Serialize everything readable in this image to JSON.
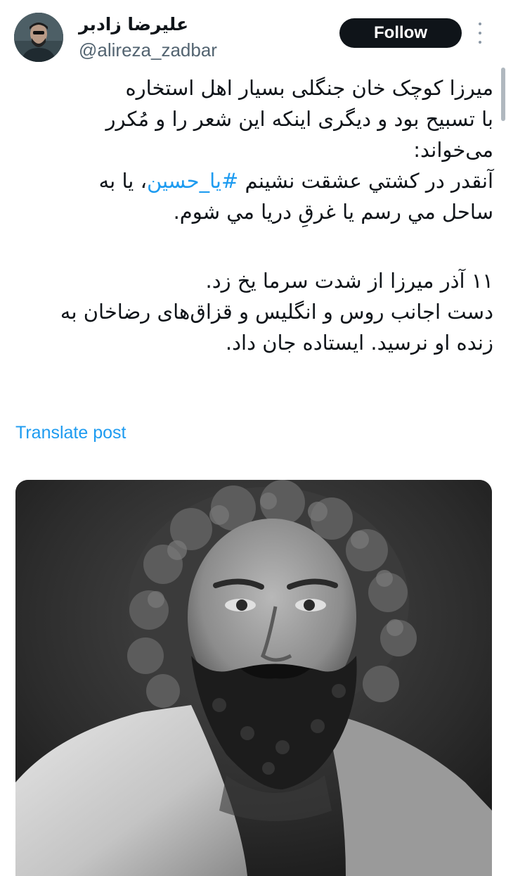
{
  "author": {
    "display_name": "علیرضا زادبر",
    "handle": "@alireza_zadbar"
  },
  "header": {
    "follow_label": "Follow",
    "more_icon": "more-vertical-icon"
  },
  "tweet": {
    "line1": "میرزا کوچک خان جنگلی بسیار اهل استخاره",
    "line2": "با تسبیح بود و دیگری اینکه این شعر را و مُکرر",
    "line3": "می‌خواند:",
    "line4_before": "آنقدر در کشتي عشقت نشينم ",
    "hashtag": "#يا_حسين",
    "line4_after": "، یا به",
    "line5": "ساحل مي رسم يا غرقِ دريا مي شوم.",
    "line6": "۱۱ آذر میرزا از شدت سرما یخ زد.",
    "line7": "دست اجانب روس و انگلیس و قزاق‌های رضاخان به",
    "line8": "زنده او نرسید. ایستاده جان داد."
  },
  "translate_label": "Translate post",
  "colors": {
    "link": "#1d9bf0",
    "text": "#0f1419",
    "secondary": "#536471",
    "button_bg": "#0f1419"
  }
}
